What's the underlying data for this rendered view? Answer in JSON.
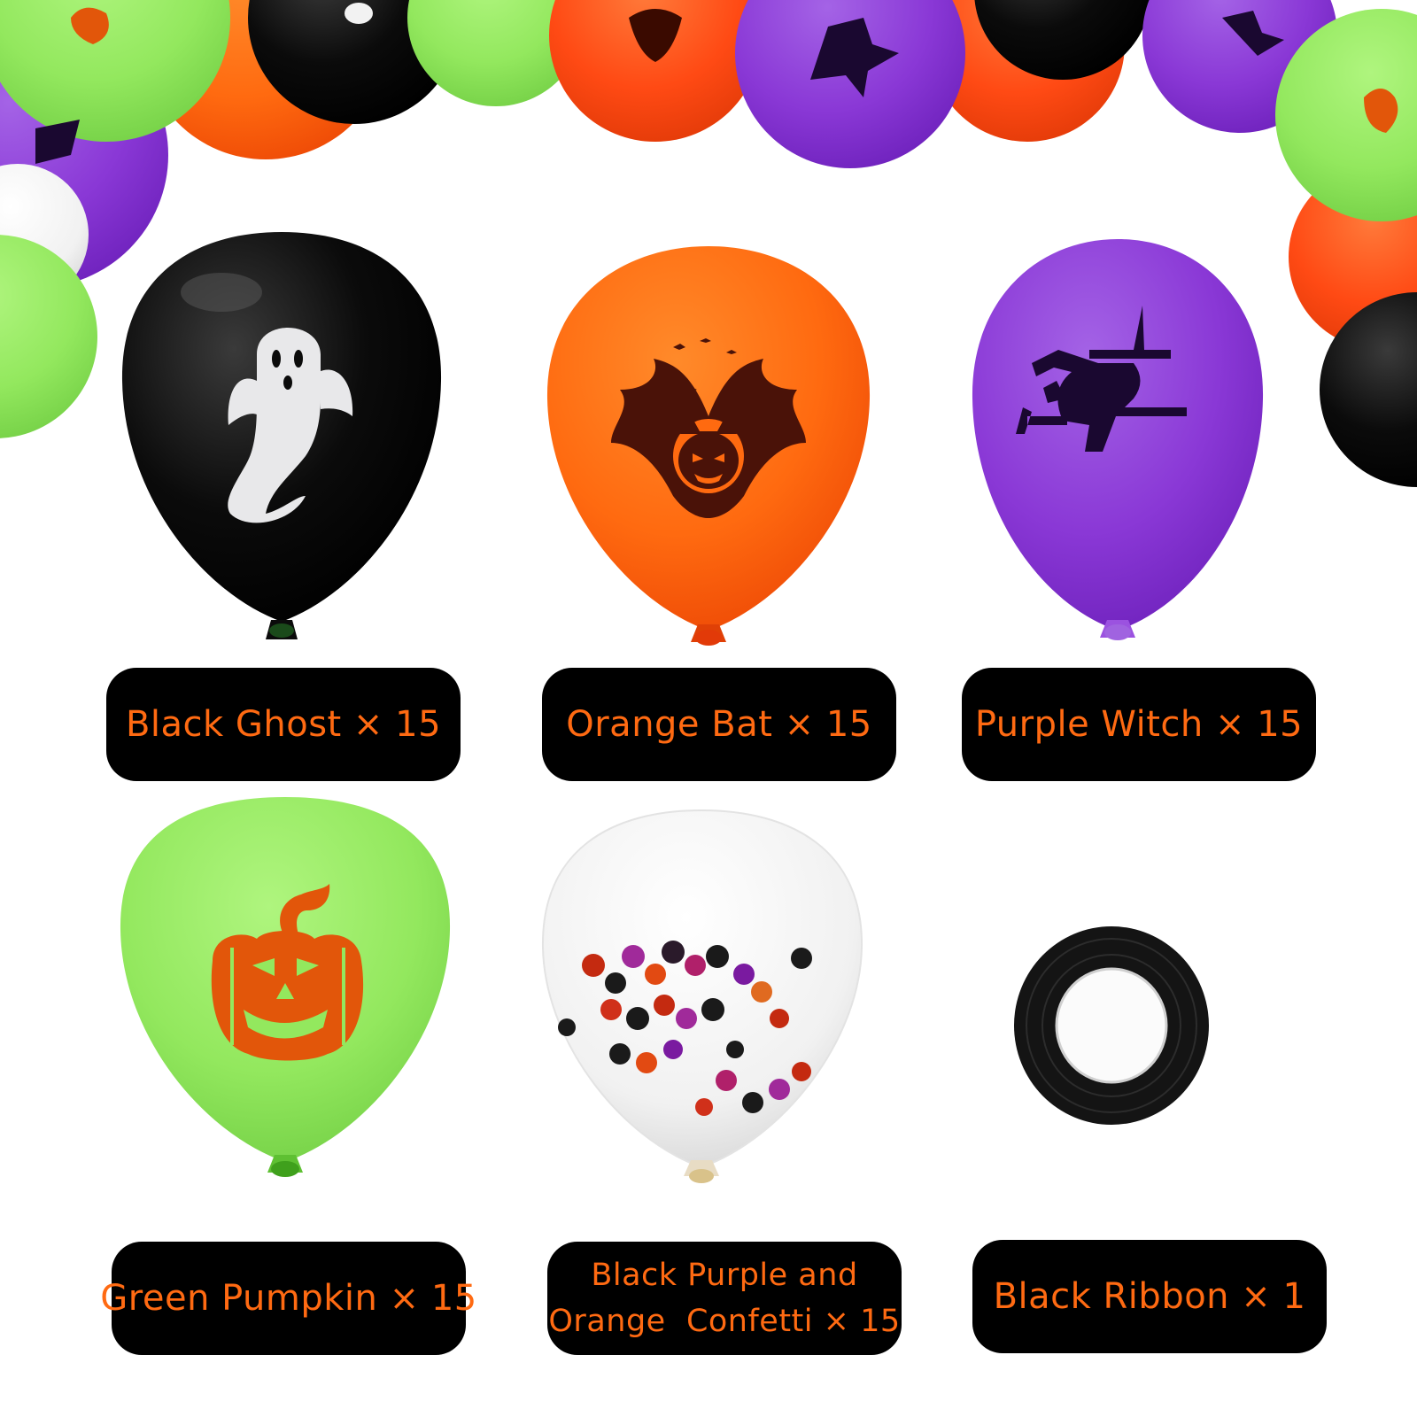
{
  "colors": {
    "label_bg": "#000000",
    "label_text": "#ff6a12",
    "black": "#0b0b0b",
    "orange": "#ff6a10",
    "purple": "#8e3ad6",
    "green": "#8ee65a",
    "clear": "#f1f1f1"
  },
  "items": [
    {
      "label": "Black Ghost × 15",
      "balloon": "black",
      "print": "ghost-icon"
    },
    {
      "label": "Orange Bat × 15",
      "balloon": "orange",
      "print": "bat-icon"
    },
    {
      "label": "Purple Witch × 15",
      "balloon": "purple",
      "print": "witch-icon"
    },
    {
      "label": "Green Pumpkin × 15",
      "balloon": "green",
      "print": "pumpkin-icon"
    },
    {
      "label_lines": [
        "Black Purple and",
        "Orange  Confetti × 15"
      ],
      "balloon": "clear",
      "print": "confetti-icon"
    },
    {
      "label": "Black Ribbon × 1",
      "print": "ribbon-icon"
    }
  ]
}
